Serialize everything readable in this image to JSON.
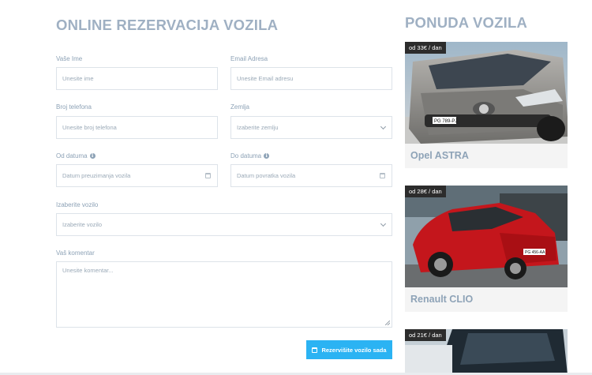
{
  "form": {
    "title": "ONLINE REZERVACIJA VOZILA",
    "name_label": "Vaše Ime",
    "name_placeholder": "Unesite ime",
    "email_label": "Email Adresa",
    "email_placeholder": "Unesite Email adresu",
    "phone_label": "Broj telefona",
    "phone_placeholder": "Unesite broj telefona",
    "country_label": "Zemlja",
    "country_value": "Izaberite zemlju",
    "from_label": "Od datuma",
    "from_placeholder": "Datum preuzimanja vozila",
    "to_label": "Do datuma",
    "to_placeholder": "Datum povratka vozila",
    "vehicle_label": "Izaberite vozilo",
    "vehicle_value": "Izaberite vozilo",
    "comment_label": "Vaš komentar",
    "comment_placeholder": "Unesite komentar...",
    "submit_label": "Rezervišite vozilo sada"
  },
  "offers": {
    "title": "PONUDA VOZILA",
    "cars": [
      {
        "price": "od 33€ / dan",
        "name": "Opel ASTRA",
        "color": "#8a8a88",
        "plate": "PG 789-PJ"
      },
      {
        "price": "od 28€ / dan",
        "name": "Renault CLIO",
        "color": "#c4161c",
        "plate": "PG 456-AA"
      },
      {
        "price": "od 21€ / dan",
        "name": "",
        "color": "#1f2a33",
        "plate": ""
      }
    ]
  },
  "colors": {
    "accent": "#2bb3f3",
    "heading": "#9fb0c3",
    "badge_bg": "#2c2c2c"
  }
}
